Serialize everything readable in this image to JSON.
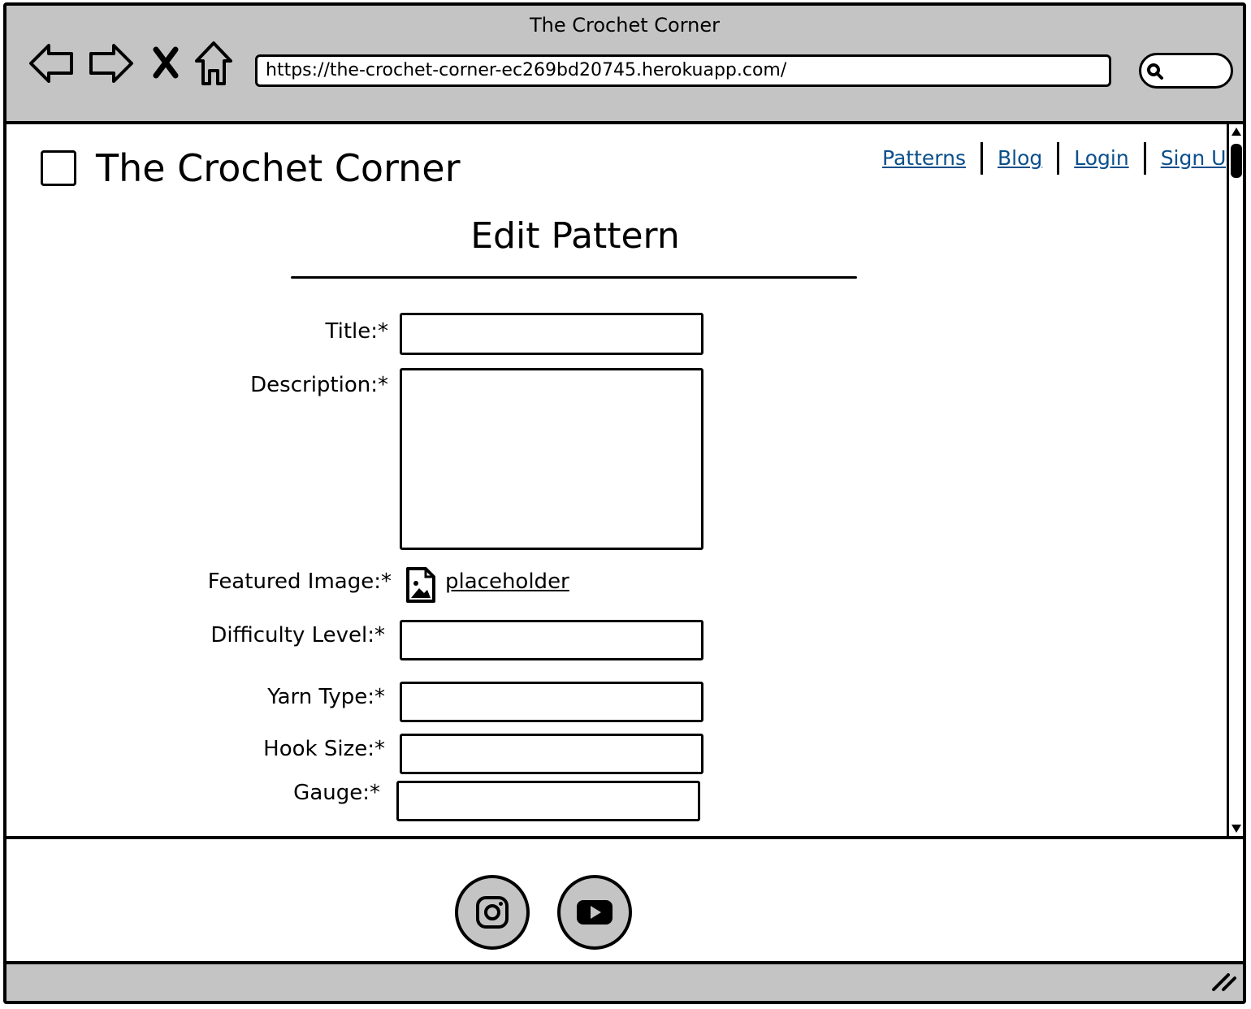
{
  "browser": {
    "window_title": "The Crochet Corner",
    "url": "https://the-crochet-corner-ec269bd20745.herokuapp.com/",
    "buttons": {
      "back": "back-arrow-icon",
      "forward": "forward-arrow-icon",
      "stop": "close-icon",
      "home": "home-icon",
      "search": "search-icon"
    }
  },
  "header": {
    "site_title": "The Crochet Corner",
    "nav": [
      "Patterns",
      "Blog",
      "Login",
      "Sign Up"
    ]
  },
  "form": {
    "heading": "Edit Pattern",
    "fields": {
      "title": {
        "label": "Title:*",
        "value": ""
      },
      "description": {
        "label": "Description:*",
        "value": ""
      },
      "featured_image": {
        "label": "Featured Image:*",
        "link_text": "placeholder",
        "icon": "image-file-icon"
      },
      "difficulty": {
        "label": "Difficulty Level:*",
        "value": ""
      },
      "yarn_type": {
        "label": "Yarn Type:*",
        "value": ""
      },
      "hook_size": {
        "label": "Hook Size:*",
        "value": ""
      },
      "gauge": {
        "label": "Gauge:*",
        "value": ""
      }
    }
  },
  "footer": {
    "social": [
      "instagram-icon",
      "youtube-icon"
    ]
  },
  "colors": {
    "chrome": "#c4c4c4",
    "link": "#0b4f8c",
    "content_bg": "#ffffff"
  }
}
